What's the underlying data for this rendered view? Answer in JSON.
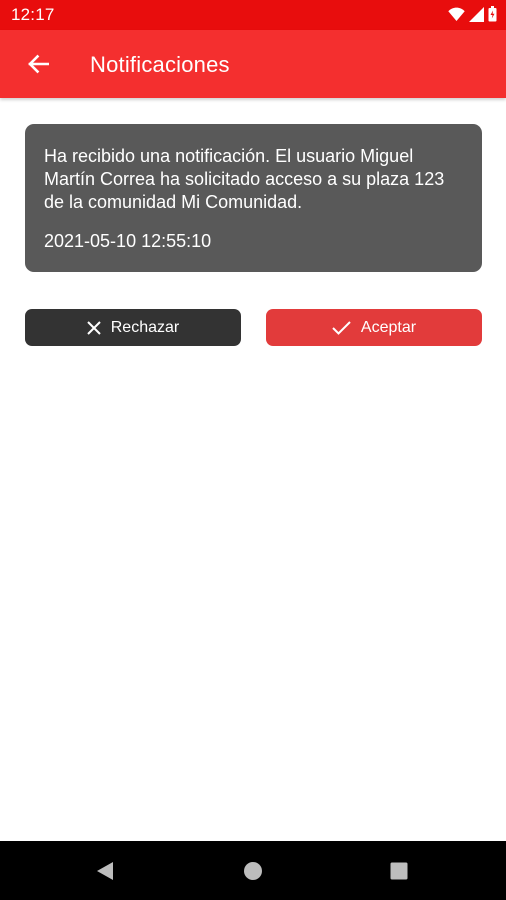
{
  "status_bar": {
    "time": "12:17",
    "icons": [
      "wifi-icon",
      "cellular-signal-icon",
      "battery-icon"
    ]
  },
  "app_bar": {
    "back_icon": "arrow-left-icon",
    "title": "Notificaciones",
    "background_color": "#f42f2f"
  },
  "notification": {
    "message": "Ha recibido una notificación. El usuario Miguel Martín Correa ha solicitado acceso a su plaza 123 de la comunidad Mi Comunidad.",
    "date": "2021-05-10 12:55:10",
    "background_color": "#595959"
  },
  "actions": {
    "reject_label": "Rechazar",
    "reject_icon": "close-icon",
    "reject_color": "#333333",
    "accept_label": "Aceptar",
    "accept_icon": "check-icon",
    "accept_color": "#e23b3b"
  },
  "navigation": {
    "buttons": [
      "back-triangle-icon",
      "home-circle-icon",
      "recents-square-icon"
    ]
  }
}
